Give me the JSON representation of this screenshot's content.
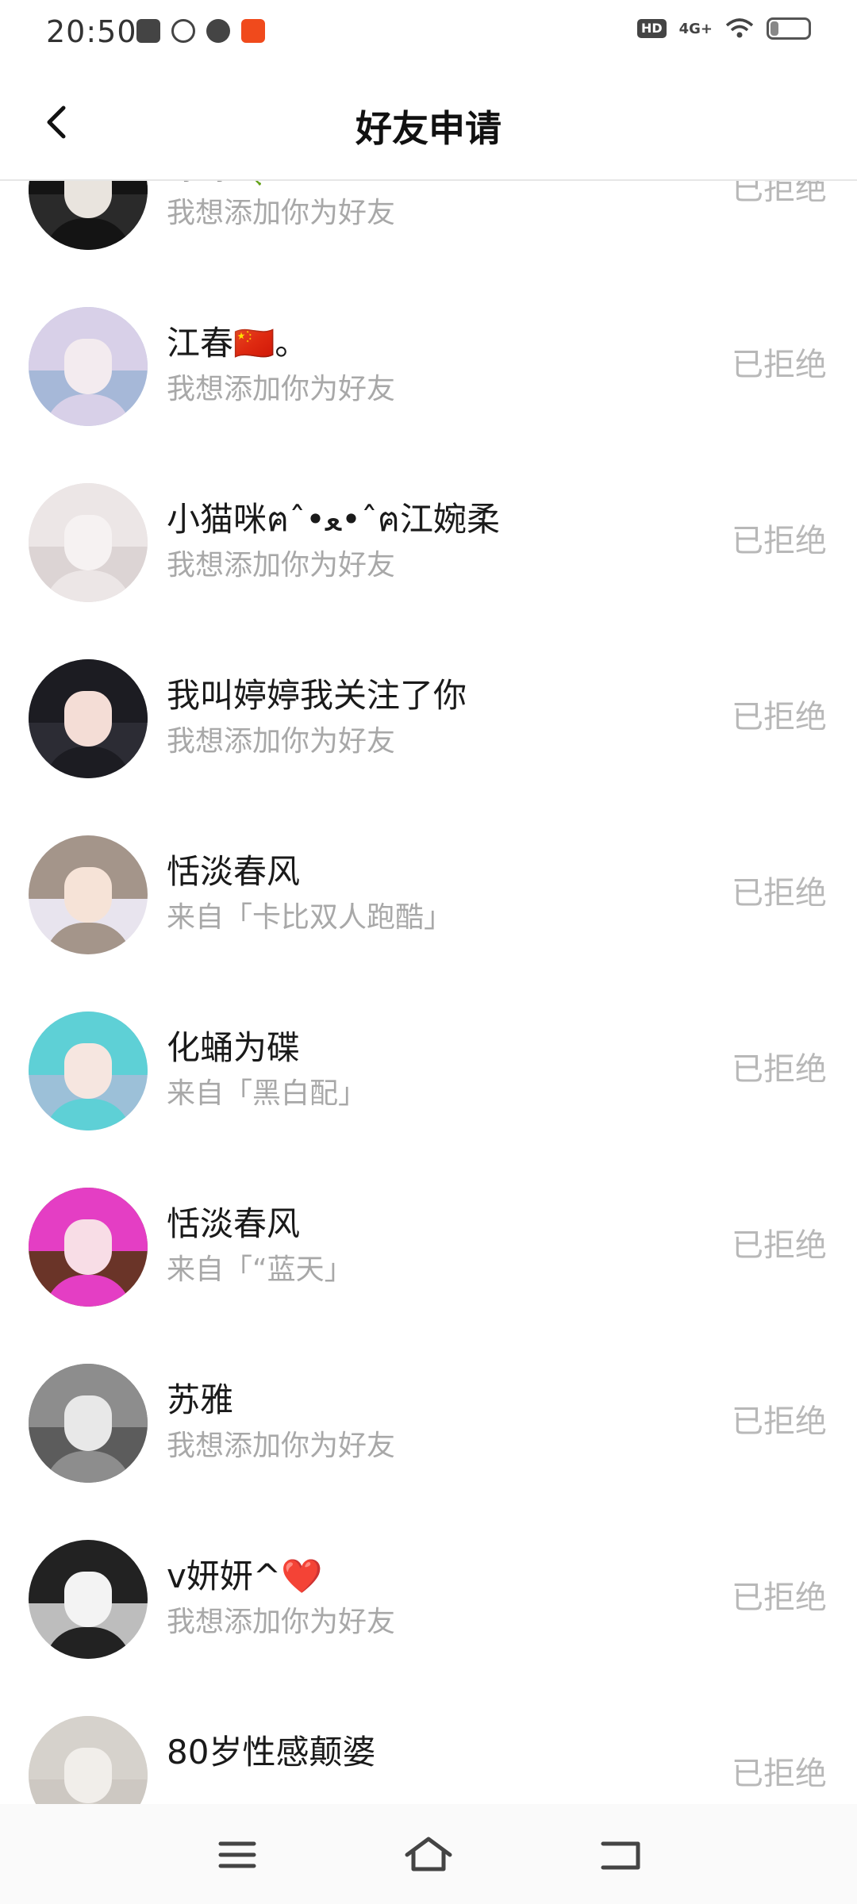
{
  "status_bar": {
    "time": "20:50",
    "hd": "HD",
    "network": "4G+",
    "battery": "19",
    "battery_level": 0.19
  },
  "header": {
    "title": "好友申请"
  },
  "requests": [
    {
      "name": "婷婷🍀",
      "subtitle": "我想添加你为好友",
      "status": "已拒绝",
      "avatar_colors": [
        "#141414",
        "#e9e4de",
        "#2a2a2a"
      ]
    },
    {
      "name": "江春🇨🇳。",
      "subtitle": "我想添加你为好友",
      "status": "已拒绝",
      "avatar_colors": [
        "#d8d0e8",
        "#f3ebef",
        "#a6b8d8"
      ]
    },
    {
      "name": "小猫咪ฅˆ•ﻌ•ˆฅ江婉柔",
      "subtitle": "我想添加你为好友",
      "status": "已拒绝",
      "avatar_colors": [
        "#ece6e6",
        "#f6f2f2",
        "#dcd4d4"
      ]
    },
    {
      "name": "我叫婷婷我关注了你",
      "subtitle": "我想添加你为好友",
      "status": "已拒绝",
      "avatar_colors": [
        "#1c1c22",
        "#f4ddd6",
        "#2c2c34"
      ]
    },
    {
      "name": "恬淡春风",
      "subtitle": "来自「卡比双人跑酷」",
      "status": "已拒绝",
      "avatar_colors": [
        "#a4958a",
        "#f6e3d7",
        "#e8e4ee"
      ]
    },
    {
      "name": "化蛹为碟",
      "subtitle": "来自「黑白配」",
      "status": "已拒绝",
      "avatar_colors": [
        "#5ed0d6",
        "#f6e6e0",
        "#9cc0d8"
      ]
    },
    {
      "name": "恬淡春风",
      "subtitle": "来自「“蓝天」",
      "status": "已拒绝",
      "avatar_colors": [
        "#e43ec4",
        "#f8dde6",
        "#6a3428"
      ]
    },
    {
      "name": "苏雅",
      "subtitle": "我想添加你为好友",
      "status": "已拒绝",
      "avatar_colors": [
        "#8d8d8d",
        "#e8e8e8",
        "#5c5c5c"
      ]
    },
    {
      "name": "v妍妍^❤️",
      "subtitle": "我想添加你为好友",
      "status": "已拒绝",
      "avatar_colors": [
        "#222222",
        "#f3f3f3",
        "#bdbdbd"
      ]
    },
    {
      "name": "80岁性感颠婆",
      "subtitle": "",
      "status": "已拒绝",
      "avatar_colors": [
        "#d6d2cc",
        "#f1eeea",
        "#cdc8c2"
      ]
    }
  ],
  "nav_bar": {
    "icons": [
      "menu-icon",
      "home-icon",
      "back-icon"
    ]
  },
  "colors": {
    "title": "#111111",
    "subtitle": "#a8a8a8",
    "status": "#b8b8b8",
    "divider": "#e6e6e6"
  }
}
